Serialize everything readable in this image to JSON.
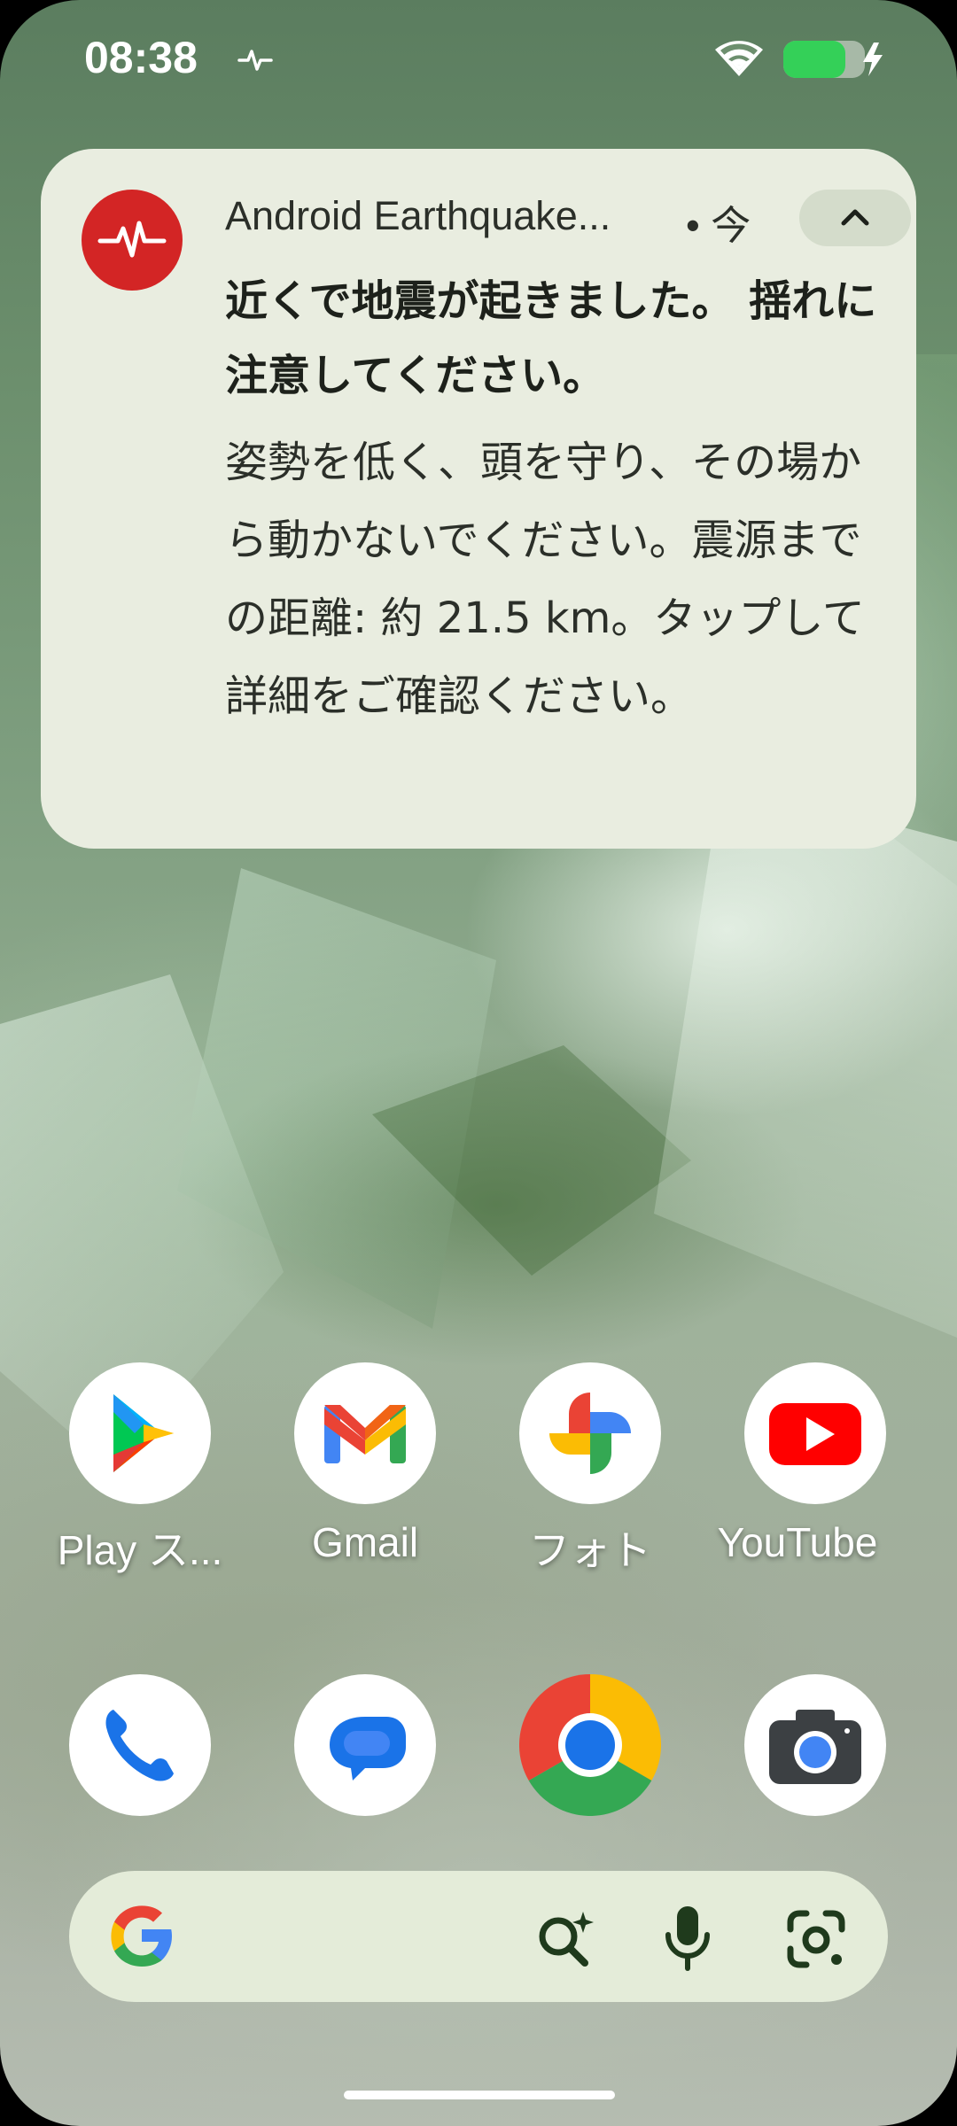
{
  "status_bar": {
    "time": "08:38",
    "icons": [
      "earthquake-alert-pulse-icon",
      "wifi-icon",
      "battery-charging-icon"
    ],
    "battery_color": "#34d058"
  },
  "notification": {
    "app_name": "Android Earthquake...",
    "time": "• 今",
    "title": "近くで地震が起きました。 揺れに注意してください。",
    "body": "姿勢を低く、頭を守り、その場から動かないでください。震源までの距離: 約 21.5 km。タップして詳細をご確認ください。",
    "icon": "earthquake-alert-icon",
    "icon_color": "#d32525",
    "background": "#e9ede0"
  },
  "apps": [
    {
      "label": "Play ス...",
      "icon": "play-store-icon"
    },
    {
      "label": "Gmail",
      "icon": "gmail-icon"
    },
    {
      "label": "フォト",
      "icon": "photos-icon"
    },
    {
      "label": "YouTube",
      "icon": "youtube-icon"
    }
  ],
  "dock": [
    {
      "icon": "phone-icon"
    },
    {
      "icon": "messages-icon"
    },
    {
      "icon": "chrome-icon"
    },
    {
      "icon": "camera-icon"
    }
  ],
  "search_bar": {
    "icons": [
      "google-logo-icon",
      "ai-search-icon",
      "microphone-icon",
      "google-lens-icon"
    ]
  }
}
